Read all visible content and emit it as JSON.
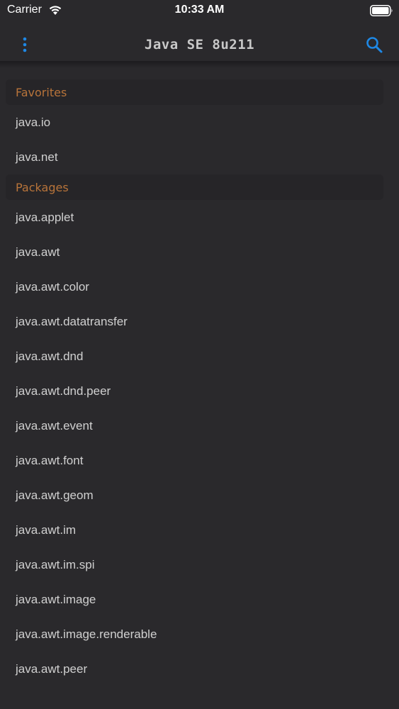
{
  "status_bar": {
    "carrier": "Carrier",
    "time": "10:33 AM"
  },
  "nav": {
    "title": "Java SE 8u211",
    "menu_icon": "vertical-dots-icon",
    "search_icon": "search-icon",
    "accent_color": "#1e88e5"
  },
  "favorites": {
    "header": "Favorites",
    "items": [
      "java.io",
      "java.net"
    ]
  },
  "packages": {
    "header": "Packages",
    "items": [
      "java.applet",
      "java.awt",
      "java.awt.color",
      "java.awt.datatransfer",
      "java.awt.dnd",
      "java.awt.dnd.peer",
      "java.awt.event",
      "java.awt.font",
      "java.awt.geom",
      "java.awt.im",
      "java.awt.im.spi",
      "java.awt.image",
      "java.awt.image.renderable",
      "java.awt.peer"
    ]
  },
  "colors": {
    "background": "#2a292c",
    "section_header_text": "#b8743a",
    "item_text": "#d0d0d0"
  }
}
